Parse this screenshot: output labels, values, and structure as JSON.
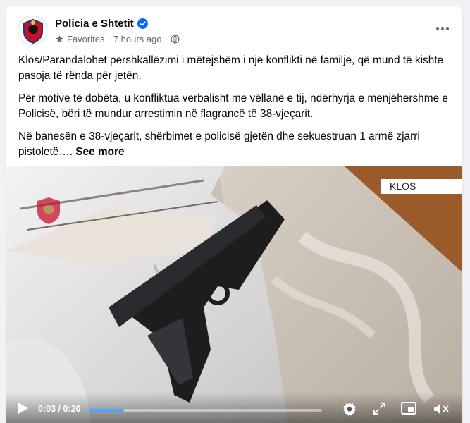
{
  "post": {
    "page_name": "Policia e Shtetit",
    "audience": "Favorites",
    "time_ago": "7 hours ago",
    "separator": "·",
    "paragraphs": [
      "Klos/Parandalohet përshkallëzimi i mëtejshëm i një konflikti në familje, që mund të kishte pasoja të rënda për jetën.",
      "Për motive të dobëta, u konfliktua verbalisht me vëllanë e tij,  ndërhyrja e menjëhershme e Policisë, bëri të mundur arrestimin në flagrancë të 38-vjeçarit.",
      "Në banesën e 38-vjeçarit, shërbimet e policisë gjetën dhe  sekuestruan 1 armë zjarri pistoletë…."
    ],
    "see_more": "See more"
  },
  "video": {
    "location_label": "KLOS",
    "current_time": "0:03",
    "duration": "0:20",
    "time_separator": " / ",
    "progress_fraction": 0.15
  },
  "icons": {
    "verified": "verified-badge-icon",
    "audience": "star-icon",
    "privacy": "globe-icon",
    "more": "more-options-icon",
    "play": "play-icon",
    "settings": "gear-icon",
    "fullscreen": "expand-icon",
    "pip": "picture-in-picture-icon",
    "volume": "muted-speaker-icon"
  },
  "colors": {
    "verified_blue": "#0866ff",
    "progress_blue": "#4da3ff",
    "secondary_text": "#65676b"
  }
}
